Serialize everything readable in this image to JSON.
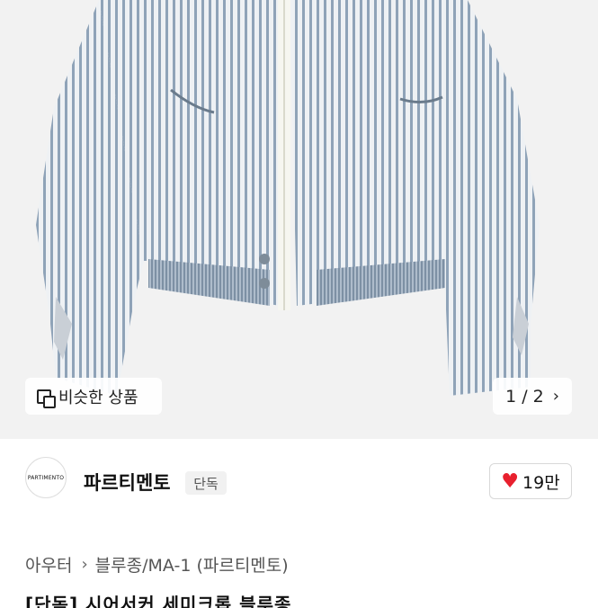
{
  "product_image": {
    "alt": "seersucker striped cropped jacket",
    "counter": "1 / 2",
    "similar_label": "비슷한 상품"
  },
  "shop": {
    "logo_text": "PARTIMENTO",
    "name": "파르티멘토",
    "badge": "단독",
    "likes": "19만"
  },
  "breadcrumb": {
    "items": [
      "아우터",
      "블루종/MA-1 (파르티멘토)"
    ]
  },
  "product_title_partial": "[단독] 시어서커 세미크롭 블루종",
  "colors": {
    "heart": "#e8202e",
    "stripe_blue": "#8fa3b8",
    "stripe_white": "#eef1f4"
  },
  "icons": [
    "similar-products-icon",
    "chevron-right-icon",
    "heart-icon"
  ]
}
